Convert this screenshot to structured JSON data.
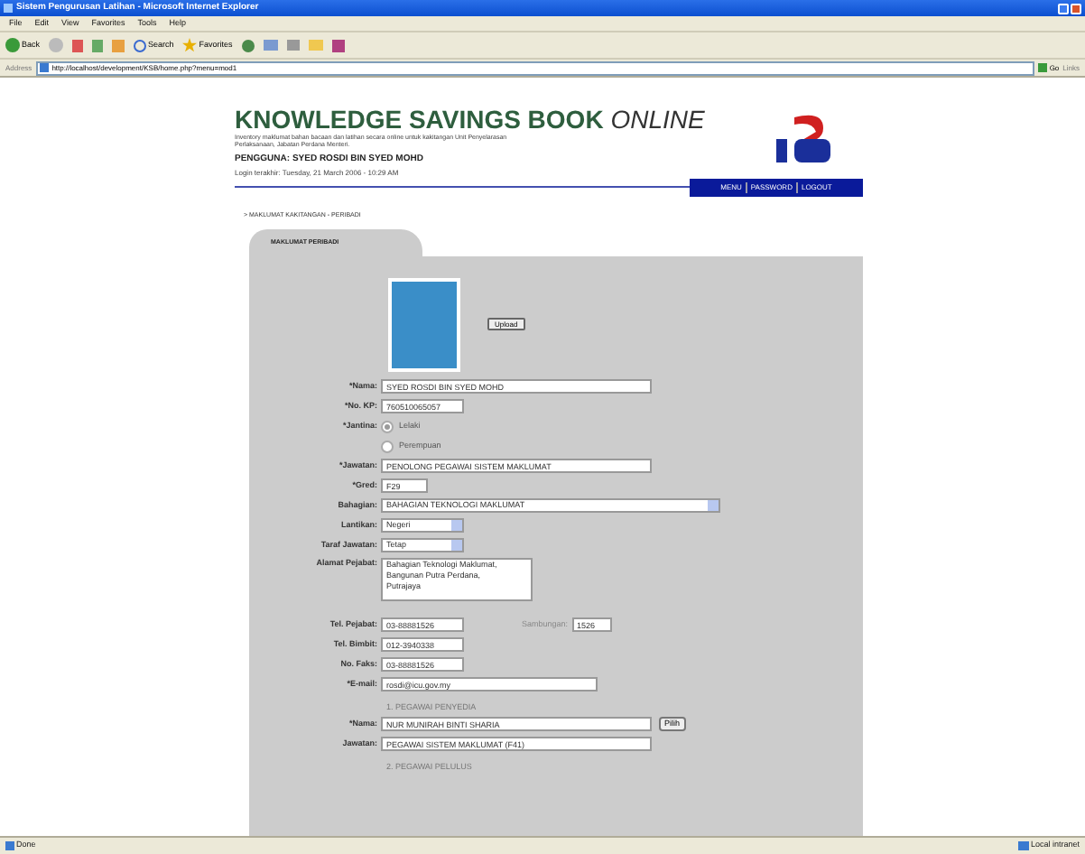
{
  "window": {
    "title": "Sistem Pengurusan Latihan - Microsoft Internet Explorer"
  },
  "menu": [
    "File",
    "Edit",
    "View",
    "Favorites",
    "Tools",
    "Help"
  ],
  "toolbar": {
    "back": "Back",
    "search": "Search",
    "favorites": "Favorites"
  },
  "address": {
    "label": "Address",
    "value": "http://localhost/development/KSB/home.php?menu=mod1",
    "go": "Go",
    "links": "Links"
  },
  "header": {
    "title": "KNOWLEDGE SAVINGS BOOK",
    "title_suffix": "ONLINE",
    "subtitle": "Inventory maklumat bahan bacaan dan latihan secara online untuk kakitangan Unit Penyelarasan Perlaksanaan, Jabatan Perdana Menteri.",
    "user": "PENGGUNA: SYED ROSDI BIN SYED MOHD",
    "last_login": "Login terakhir: Tuesday, 21 March 2006 - 10:29 AM"
  },
  "nav": [
    "MENU",
    "PASSWORD",
    "LOGOUT"
  ],
  "breadcrumb": "> MAKLUMAT KAKITANGAN - PERIBADI",
  "tab": {
    "label": "MAKLUMAT PERIBADI",
    "selected": true
  },
  "upload_button": "Upload",
  "fields": [
    {
      "kind": "text",
      "label": "*Nama:",
      "value": "SYED ROSDI BIN SYED MOHD"
    },
    {
      "kind": "text",
      "label": "*No. KP:",
      "value": "760510065057"
    },
    {
      "kind": "radio",
      "label": "*Jantina:",
      "options": [
        {
          "label": "Lelaki",
          "selected": true
        },
        {
          "label": "Perempuan",
          "selected": false
        }
      ]
    },
    {
      "kind": "text",
      "label": "*Jawatan:",
      "value": "PENOLONG PEGAWAI SISTEM MAKLUMAT"
    },
    {
      "kind": "text",
      "label": "*Gred:",
      "value": "F29"
    },
    {
      "kind": "select",
      "label": "Bahagian:",
      "value": "BAHAGIAN TEKNOLOGI MAKLUMAT"
    },
    {
      "kind": "select",
      "label": "Lantikan:",
      "value": "Negeri"
    },
    {
      "kind": "select",
      "label": "Taraf Jawatan:",
      "value": "Tetap"
    },
    {
      "kind": "textarea",
      "label": "Alamat Pejabat:",
      "value": "Bahagian Teknologi Maklumat,\nBangunan Putra Perdana,\nPutrajaya"
    },
    {
      "kind": "text",
      "label": "Tel. Pejabat:",
      "value": "03-88881526",
      "extra": {
        "label": "Sambungan:",
        "value": "1526"
      }
    },
    {
      "kind": "text",
      "label": "Tel. Bimbit:",
      "value": "012-3940338"
    },
    {
      "kind": "text",
      "label": "No. Faks:",
      "value": "03-88881526"
    },
    {
      "kind": "text",
      "label": "*E-mail:",
      "value": "rosdi@icu.gov.my"
    },
    {
      "kind": "section",
      "label": "1. PEGAWAI PENYEDIA"
    },
    {
      "kind": "text",
      "label": "*Nama:",
      "value": "NUR MUNIRAH BINTI SHARIA",
      "button": "Pilih"
    },
    {
      "kind": "text",
      "label": "Jawatan:",
      "value": "PEGAWAI SISTEM MAKLUMAT (F41)"
    },
    {
      "kind": "section",
      "label": "2. PEGAWAI PELULUS"
    }
  ],
  "status_bar": {
    "text": "Done",
    "zone": "Local intranet"
  }
}
